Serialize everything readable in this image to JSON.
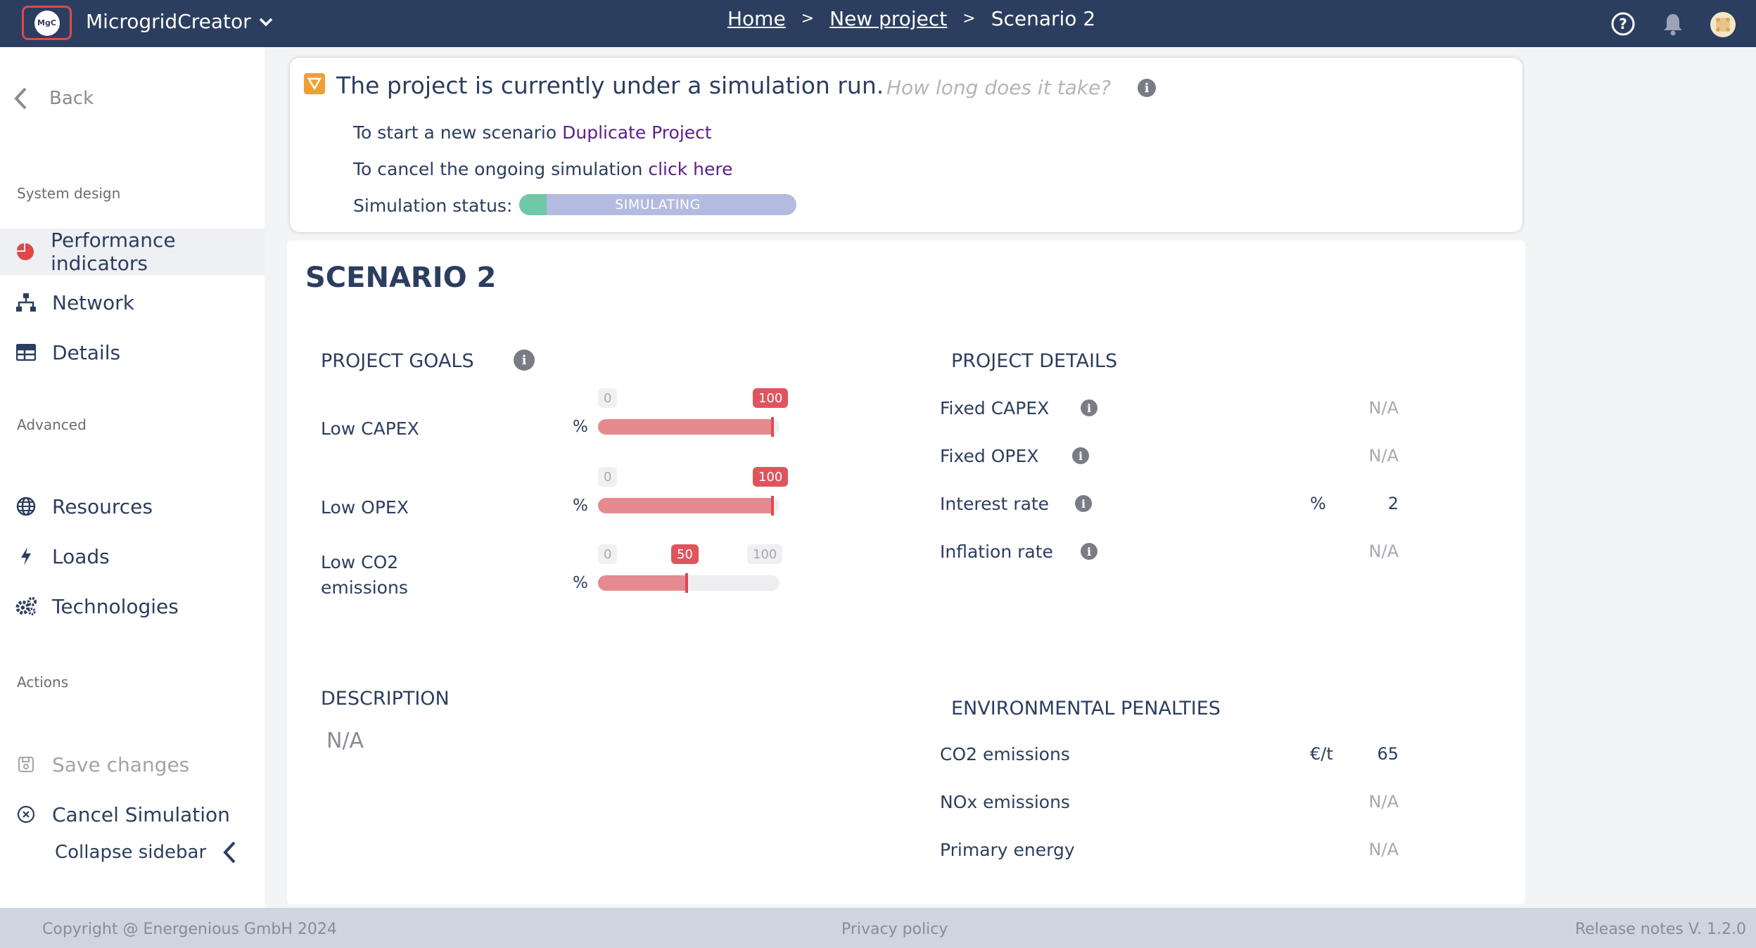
{
  "header": {
    "app_name": "MicrogridCreator",
    "logo_text": "MgC",
    "breadcrumb": [
      "Home",
      "New project",
      "Scenario 2"
    ],
    "icons": [
      "help-icon",
      "bell-icon",
      "avatar"
    ]
  },
  "sidebar": {
    "back_label": "Back",
    "section_system": "System design",
    "section_advanced": "Advanced",
    "section_actions": "Actions",
    "items": {
      "performance": "Performance indicators",
      "network": "Network",
      "details": "Details",
      "resources": "Resources",
      "loads": "Loads",
      "technologies": "Technologies",
      "save": "Save changes",
      "cancel": "Cancel Simulation"
    },
    "collapse_label": "Collapse sidebar"
  },
  "alert": {
    "title": "The project is currently under a simulation run.",
    "question": "How long does it take?",
    "line1_text": "To start a new scenario ",
    "line1_link": "Duplicate Project",
    "line2_text": "To cancel the ongoing simulation ",
    "line2_link": "click here",
    "status_label": "Simulation status:",
    "status_value": "SIMULATING",
    "status_progress": 0.1
  },
  "scenario": {
    "title": "SCENARIO 2",
    "goals_title": "PROJECT GOALS",
    "goals": [
      {
        "label": "Low CAPEX",
        "unit": "%",
        "min": "0",
        "max": "100",
        "value": "100",
        "fraction": 1.0
      },
      {
        "label": "Low OPEX",
        "unit": "%",
        "min": "0",
        "max": "100",
        "value": "100",
        "fraction": 1.0
      },
      {
        "label": "Low CO2 emissions",
        "unit": "%",
        "min": "0",
        "max": "100",
        "value": "50",
        "fraction": 0.5
      }
    ],
    "details_title": "PROJECT DETAILS",
    "details": [
      {
        "label": "Fixed CAPEX",
        "unit": "",
        "value": "N/A"
      },
      {
        "label": "Fixed OPEX",
        "unit": "",
        "value": "N/A"
      },
      {
        "label": "Interest rate",
        "unit": "%",
        "value": "2"
      },
      {
        "label": "Inflation rate",
        "unit": "",
        "value": "N/A"
      }
    ],
    "description_title": "DESCRIPTION",
    "description_value": "N/A",
    "penalties_title": "ENVIRONMENTAL PENALTIES",
    "penalties": [
      {
        "label": "CO2 emissions",
        "unit": "€/t",
        "value": "65"
      },
      {
        "label": "NOx emissions",
        "unit": "",
        "value": "N/A"
      },
      {
        "label": "Primary energy",
        "unit": "",
        "value": "N/A"
      }
    ]
  },
  "footer": {
    "copyright": "Copyright @ Energenious GmbH 2024",
    "privacy": "Privacy policy",
    "release": "Release notes V. 1.2.0"
  },
  "colors": {
    "header_bg": "#2c3e5f",
    "slider_fill": "#e68a90",
    "slider_badge": "#e0545e",
    "progress_bg": "#b3bbe0",
    "progress_fill": "#6fc8a8",
    "alert_icon": "#f0a033",
    "link": "#5a1f8a"
  }
}
